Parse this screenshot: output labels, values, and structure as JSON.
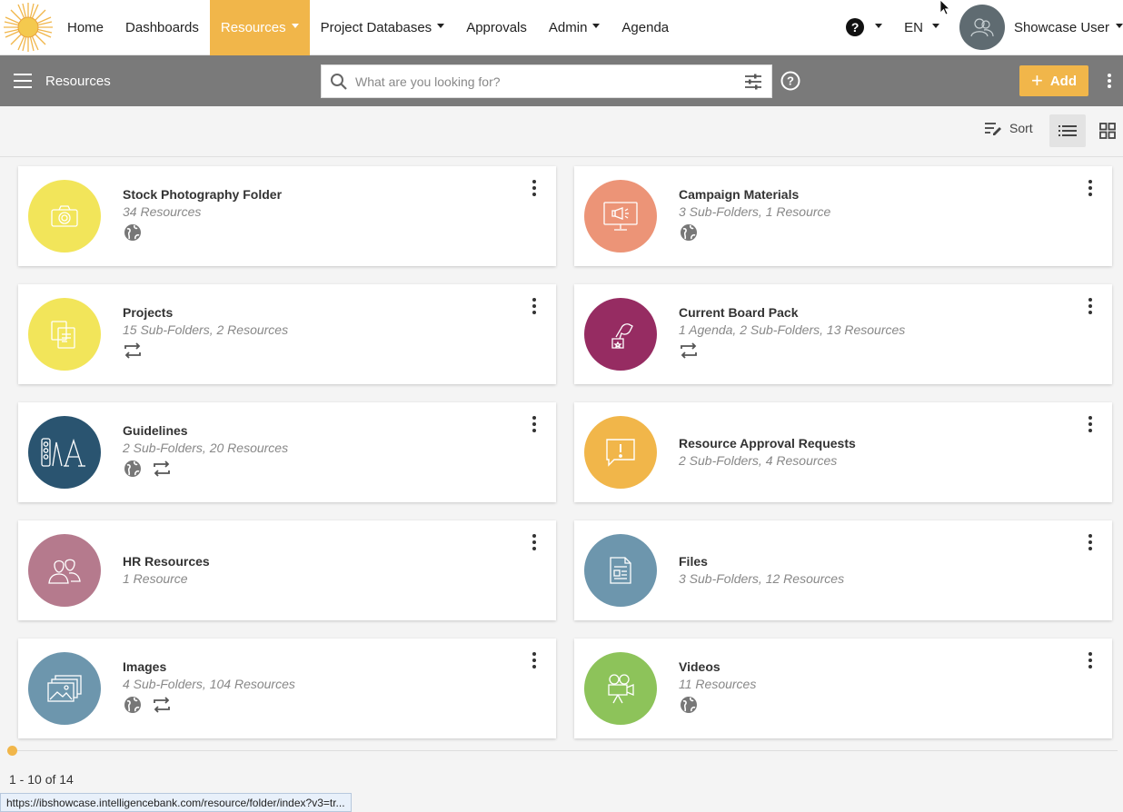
{
  "topnav": {
    "items": [
      {
        "label": "Home",
        "caret": false
      },
      {
        "label": "Dashboards",
        "caret": false
      },
      {
        "label": "Resources",
        "caret": true,
        "active": true
      },
      {
        "label": "Project Databases",
        "caret": true
      },
      {
        "label": "Approvals",
        "caret": false
      },
      {
        "label": "Admin",
        "caret": true
      },
      {
        "label": "Agenda",
        "caret": false
      }
    ],
    "language": "EN",
    "user_name": "Showcase User"
  },
  "toolbar": {
    "breadcrumb": "Resources",
    "search_placeholder": "What are you looking for?",
    "add_label": "Add"
  },
  "sortbar": {
    "sort_label": "Sort"
  },
  "folders": [
    {
      "title": "Stock Photography Folder",
      "subtitle": "34 Resources",
      "color": "#f2e55a",
      "icon": "camera-icon",
      "badges": [
        "globe"
      ]
    },
    {
      "title": "Campaign Materials",
      "subtitle": "3 Sub-Folders, 1 Resource",
      "color": "#ec9477",
      "icon": "monitor-megaphone-icon",
      "badges": [
        "globe"
      ]
    },
    {
      "title": "Projects",
      "subtitle": "15 Sub-Folders, 2 Resources",
      "color": "#f2e55a",
      "icon": "documents-icon",
      "badges": [
        "sync"
      ]
    },
    {
      "title": "Current Board Pack",
      "subtitle": "1 Agenda, 2 Sub-Folders, 13 Resources",
      "color": "#962c62",
      "icon": "hand-vote-icon",
      "badges": [
        "sync"
      ]
    },
    {
      "title": "Guidelines",
      "subtitle": "2 Sub-Folders, 20 Resources",
      "color": "#2a5470",
      "icon": "typography-icon",
      "badges": [
        "globe",
        "sync"
      ]
    },
    {
      "title": "Resource Approval Requests",
      "subtitle": "2 Sub-Folders, 4 Resources",
      "color": "#f1b64a",
      "icon": "alert-chat-icon",
      "badges": []
    },
    {
      "title": "HR Resources",
      "subtitle": "1 Resource",
      "color": "#b57a8d",
      "icon": "people-icon",
      "badges": []
    },
    {
      "title": "Files",
      "subtitle": "3 Sub-Folders, 12 Resources",
      "color": "#6d96ad",
      "icon": "file-icon",
      "badges": []
    },
    {
      "title": "Images",
      "subtitle": "4 Sub-Folders, 104 Resources",
      "color": "#6d96ad",
      "icon": "images-icon",
      "badges": [
        "globe",
        "sync"
      ]
    },
    {
      "title": "Videos",
      "subtitle": "11 Resources",
      "color": "#8dc35a",
      "icon": "video-camera-icon",
      "badges": [
        "globe"
      ]
    }
  ],
  "footer": {
    "pager": "1 - 10 of 14",
    "status_url": "https://ibshowcase.intelligencebank.com/resource/folder/index?v3=tr..."
  },
  "colors": {
    "accent": "#f1b64a",
    "toolbar": "#7a7a7a"
  }
}
